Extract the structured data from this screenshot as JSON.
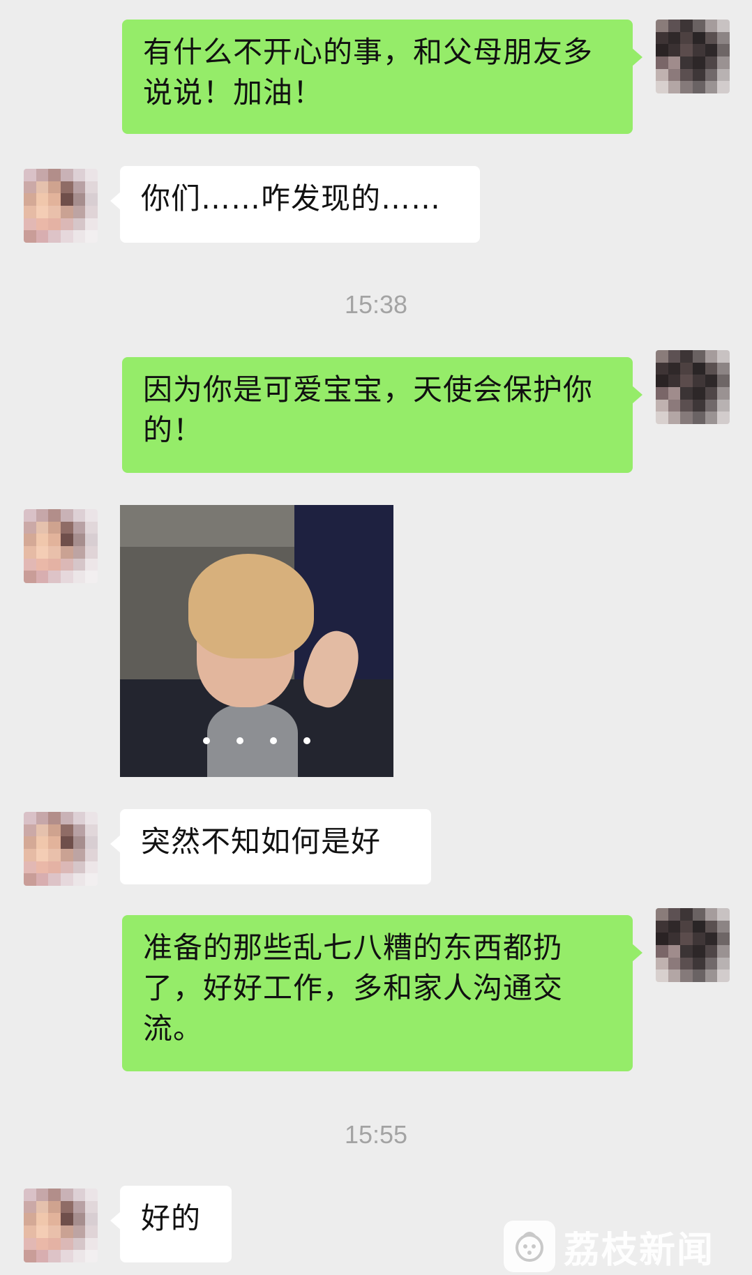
{
  "messages": [
    {
      "from": "me",
      "text": "有什么不开心的事，和父母朋友多说说！加油！"
    },
    {
      "from": "other",
      "text": "你们……咋发现的……"
    },
    {
      "timestamp": "15:38"
    },
    {
      "from": "me",
      "text": "因为你是可爱宝宝，天使会保护你的！"
    },
    {
      "from": "other",
      "type": "sticker",
      "sticker": "animated-gif-person-gesturing"
    },
    {
      "from": "other",
      "text": "突然不知如何是好"
    },
    {
      "from": "me",
      "text": "准备的那些乱七八糟的东西都扔了，好好工作，多和家人沟通交流。"
    },
    {
      "timestamp": "15:55"
    },
    {
      "from": "other",
      "text": "好的"
    }
  ],
  "watermark": {
    "text": "荔枝新闻",
    "logo": "litchi-news-logo"
  },
  "colors": {
    "background": "#ededed",
    "outgoing_bubble": "#95ec69",
    "incoming_bubble": "#ffffff",
    "timestamp": "#a3a3a3"
  }
}
